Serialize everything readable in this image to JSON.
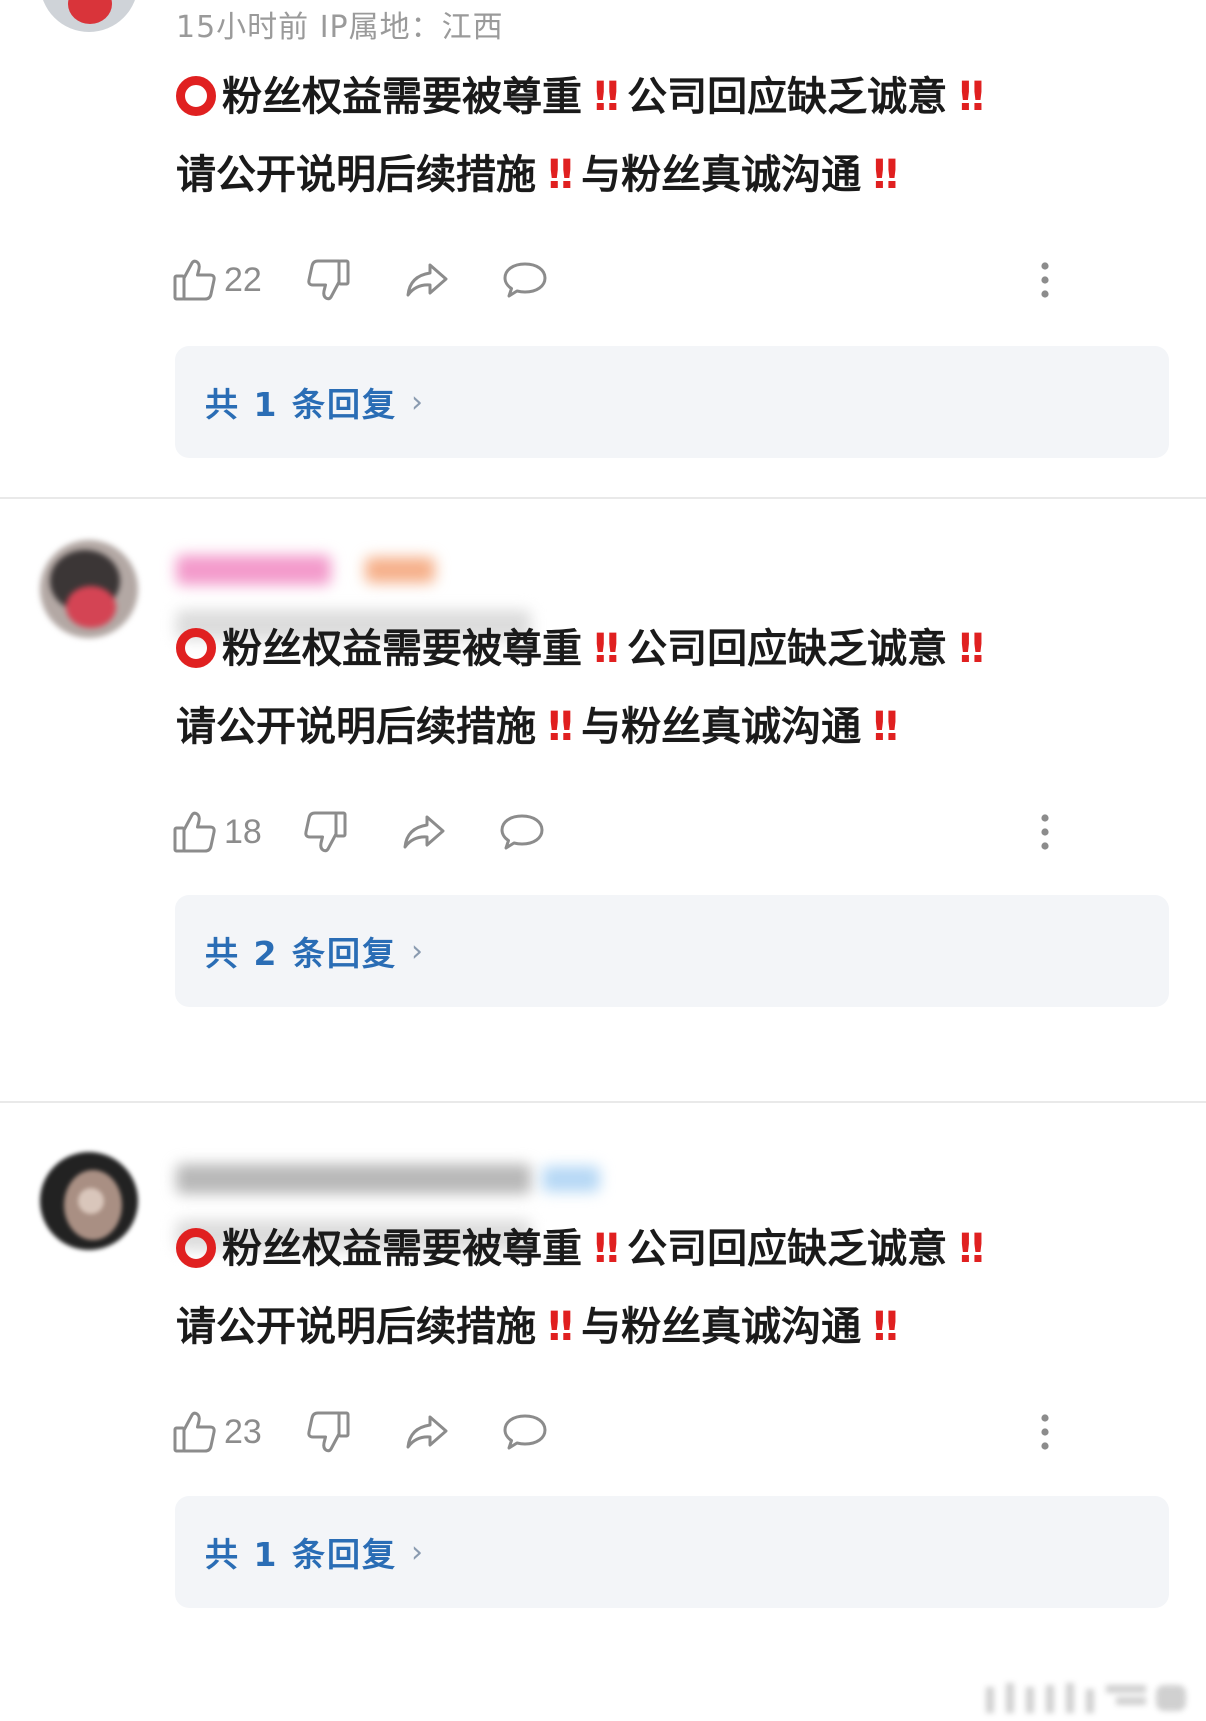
{
  "comments": [
    {
      "meta_text": "15小时前  IP属地：江西",
      "content_line1": {
        "a": "粉丝权益需要被尊重",
        "bang1": "‼",
        "b": "公司回应缺乏诚意",
        "bang2": "‼"
      },
      "content_line2": {
        "a": "请公开说明后续措施",
        "bang1": "‼",
        "b": "与粉丝真诚沟通",
        "bang2": "‼"
      },
      "like_count": "22",
      "reply_label": "共 1 条回复",
      "reply_chevron": "›"
    },
    {
      "meta_text": "",
      "content_line1": {
        "a": "粉丝权益需要被尊重",
        "bang1": "‼",
        "b": "公司回应缺乏诚意",
        "bang2": "‼"
      },
      "content_line2": {
        "a": "请公开说明后续措施",
        "bang1": "‼",
        "b": "与粉丝真诚沟通",
        "bang2": "‼"
      },
      "like_count": "18",
      "reply_label": "共 2 条回复",
      "reply_chevron": "›"
    },
    {
      "meta_text": "",
      "content_line1": {
        "a": "粉丝权益需要被尊重",
        "bang1": "‼",
        "b": "公司回应缺乏诚意",
        "bang2": "‼"
      },
      "content_line2": {
        "a": "请公开说明后续措施",
        "bang1": "‼",
        "b": "与粉丝真诚沟通",
        "bang2": "‼"
      },
      "like_count": "23",
      "reply_label": "共 1 条回复",
      "reply_chevron": "›"
    }
  ],
  "icons": {
    "like": "thumbs-up-icon",
    "dislike": "thumbs-down-icon",
    "share": "share-arrow-icon",
    "comment": "comment-bubble-icon",
    "more": "more-vertical-icon",
    "circle": "red-hollow-circle-emoji",
    "exclaim": "double-exclamation-emoji"
  },
  "colors": {
    "emoji_red": "#e02020",
    "reply_link": "#2a6db5",
    "reply_bg": "#f3f5f8",
    "meta_gray": "#9a9a9a",
    "icon_gray": "#8c8c8c"
  }
}
